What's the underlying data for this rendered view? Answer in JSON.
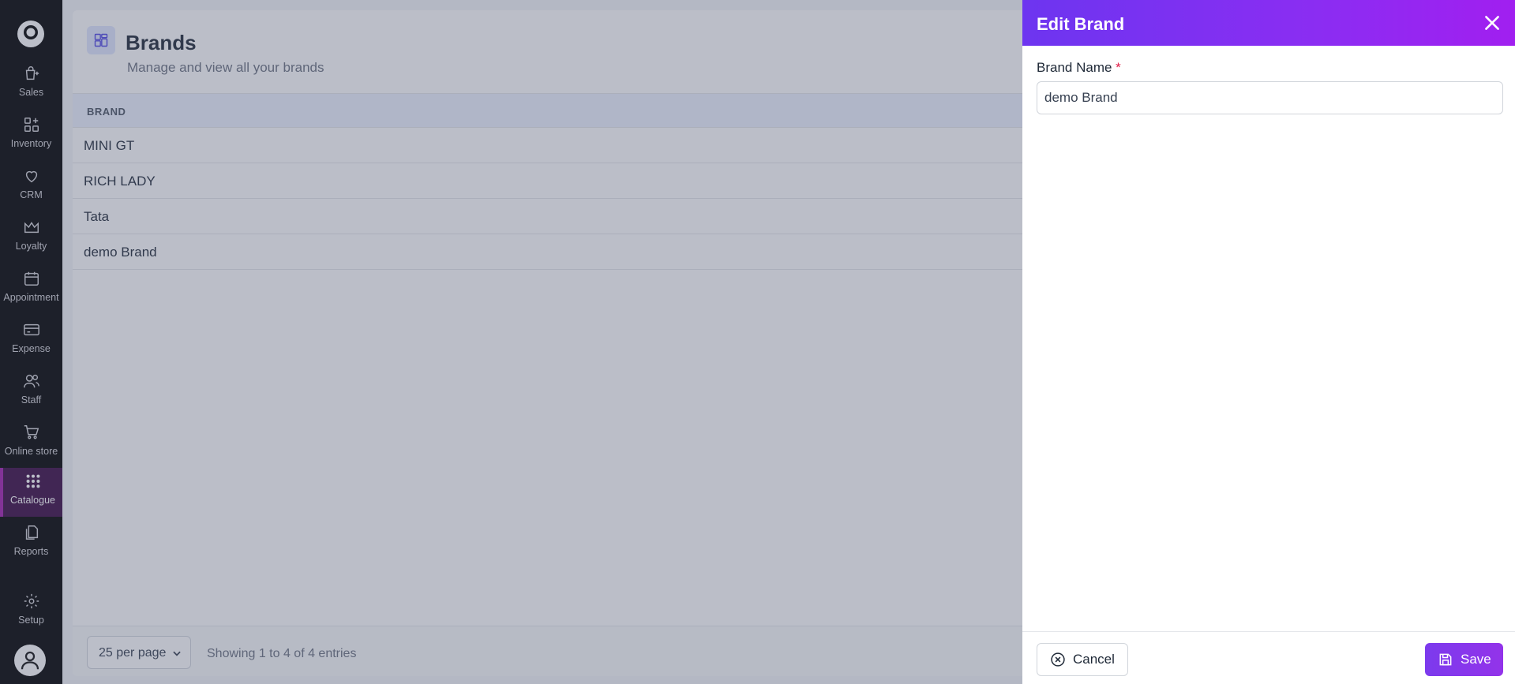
{
  "sidebar": {
    "items": [
      {
        "label": "Sales",
        "icon": "shopping-bag-icon"
      },
      {
        "label": "Inventory",
        "icon": "grid-plus-icon"
      },
      {
        "label": "CRM",
        "icon": "heart-icon"
      },
      {
        "label": "Loyalty",
        "icon": "crown-icon"
      },
      {
        "label": "Appointment",
        "icon": "calendar-icon"
      },
      {
        "label": "Expense",
        "icon": "credit-card-icon"
      },
      {
        "label": "Staff",
        "icon": "users-icon"
      },
      {
        "label": "Online store",
        "icon": "cart-icon"
      },
      {
        "label": "Catalogue",
        "icon": "dots-grid-icon",
        "active": true
      },
      {
        "label": "Reports",
        "icon": "documents-icon"
      },
      {
        "label": "Setup",
        "icon": "gear-icon"
      }
    ],
    "active_color": "#a31fb0"
  },
  "page": {
    "title": "Brands",
    "subtitle": "Manage and view all your brands"
  },
  "table": {
    "columns": [
      "BRAND"
    ],
    "rows": [
      "MINI GT",
      "RICH LADY",
      "Tata",
      "demo Brand"
    ]
  },
  "pagination": {
    "per_page": "25 per page",
    "showing": "Showing 1 to 4 of 4 entries"
  },
  "drawer": {
    "title": "Edit Brand",
    "field_label": "Brand Name",
    "required_mark": "*",
    "field_value": "demo Brand",
    "cancel_label": "Cancel",
    "save_label": "Save",
    "header_gradient": [
      "#6d35f0",
      "#a11ff0"
    ]
  }
}
